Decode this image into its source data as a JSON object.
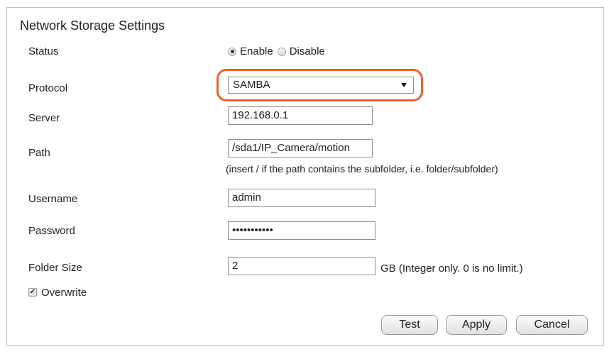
{
  "title": "Network Storage Settings",
  "status": {
    "label": "Status",
    "enable_label": "Enable",
    "disable_label": "Disable",
    "selected": "Enable"
  },
  "protocol": {
    "label": "Protocol",
    "value": "SAMBA",
    "highlight_color": "#e8642a"
  },
  "server": {
    "label": "Server",
    "value": "192.168.0.1"
  },
  "path": {
    "label": "Path",
    "value": "/sda1/IP_Camera/motion",
    "note": "(insert / if the path contains the subfolder, i.e. folder/subfolder)"
  },
  "username": {
    "label": "Username",
    "value": "admin"
  },
  "password": {
    "label": "Password",
    "value": "•••••••••••"
  },
  "folder_size": {
    "label": "Folder Size",
    "value": "2",
    "note": "GB (Integer only. 0 is no limit.)"
  },
  "overwrite": {
    "label": "Overwrite",
    "checked": true
  },
  "buttons": {
    "test": "Test",
    "apply": "Apply",
    "cancel": "Cancel"
  }
}
